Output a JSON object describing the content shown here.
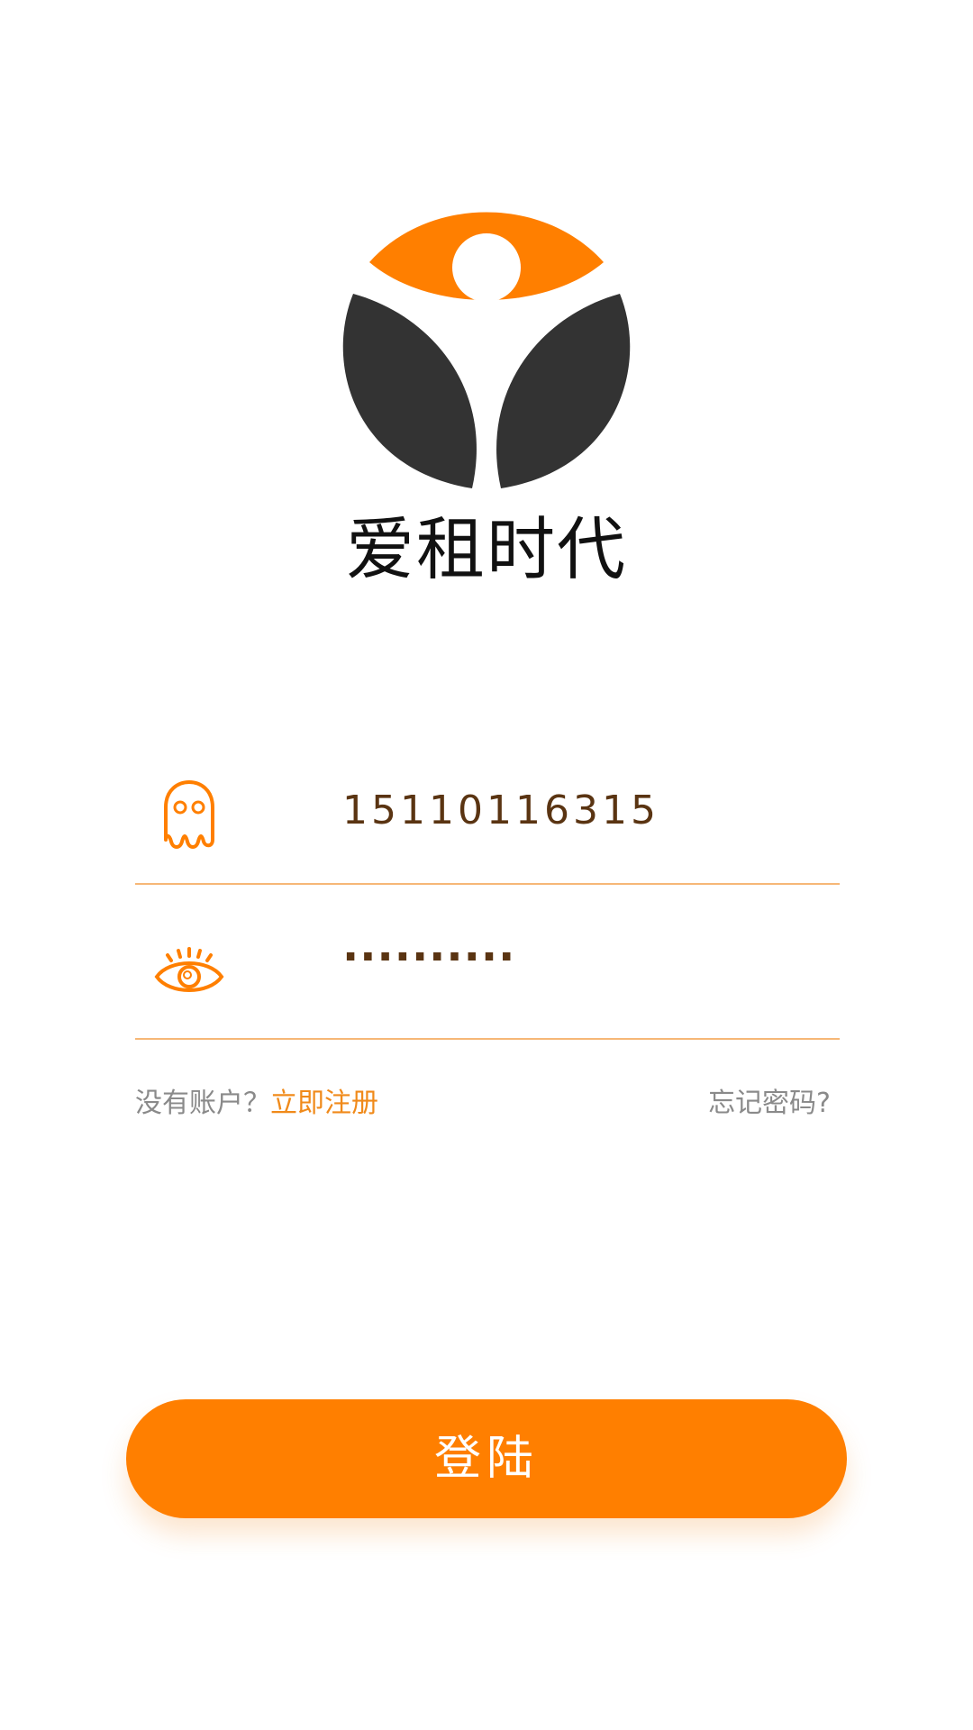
{
  "app": {
    "brand_name": "爱租时代",
    "colors": {
      "accent": "#ff7f00",
      "logo_dark": "#333333",
      "divider": "#f6b777",
      "muted_text": "#8a8a8a",
      "input_text": "#5a3412"
    }
  },
  "form": {
    "username": {
      "icon": "ghost-icon",
      "value": "15110116315"
    },
    "password": {
      "icon": "eye-icon",
      "value": "··········"
    }
  },
  "links": {
    "no_account_text": "没有账户？",
    "register_label": "立即注册",
    "forgot_password_label": "忘记密码?"
  },
  "actions": {
    "login_label": "登陆"
  }
}
